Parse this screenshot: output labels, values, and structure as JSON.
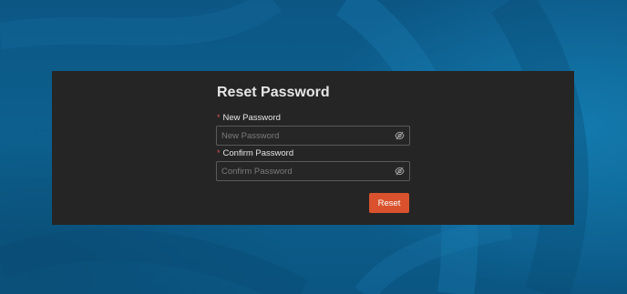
{
  "form": {
    "title": "Reset Password",
    "new_password": {
      "label": "New Password",
      "required_mark": "*",
      "placeholder": "New Password",
      "value": "",
      "icon": "eye-slash-icon"
    },
    "confirm_password": {
      "label": "Confirm Password",
      "required_mark": "*",
      "placeholder": "Confirm Password",
      "value": "",
      "icon": "eye-slash-icon"
    },
    "submit_label": "Reset"
  },
  "colors": {
    "background": "#0f5f8f",
    "panel": "#252525",
    "accent": "#d9522d",
    "required": "#d9534f"
  }
}
